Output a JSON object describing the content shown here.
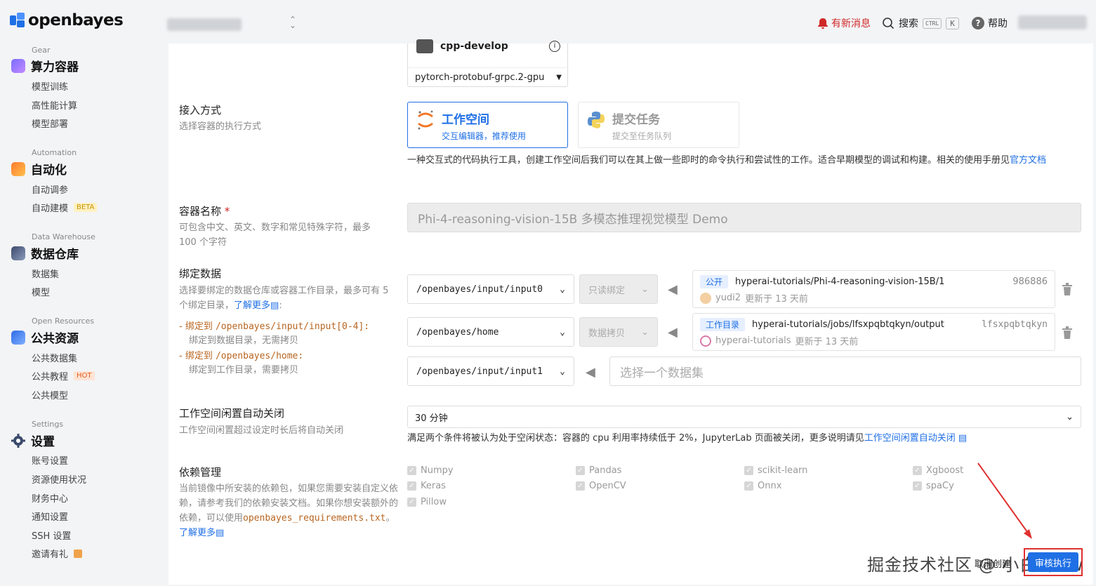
{
  "topbar": {
    "logo_text": "openbayes",
    "notification_label": "有新消息",
    "search_label": "搜索",
    "search_kbd_ctrl": "CTRL",
    "search_kbd_k": "K",
    "help_label": "帮助"
  },
  "sidebar": {
    "sections": [
      {
        "en": "Gear",
        "title": "算力容器",
        "items": [
          "模型训练",
          "高性能计算",
          "模型部署"
        ]
      },
      {
        "en": "Automation",
        "title": "自动化",
        "items": [
          "自动调参",
          "自动建模"
        ],
        "badge": "BETA"
      },
      {
        "en": "Data Warehouse",
        "title": "数据仓库",
        "items": [
          "数据集",
          "模型"
        ]
      },
      {
        "en": "Open Resources",
        "title": "公共资源",
        "items": [
          "公共数据集",
          "公共教程",
          "公共模型"
        ],
        "badge": "HOT"
      },
      {
        "en": "Settings",
        "title": "设置",
        "items": [
          "账号设置",
          "资源使用状况",
          "财务中心",
          "通知设置",
          "SSH 设置",
          "邀请有礼"
        ]
      }
    ]
  },
  "image": {
    "name": "cpp-develop",
    "version": "pytorch-protobuf-grpc.2-gpu"
  },
  "access": {
    "label": "接入方式",
    "desc": "选择容器的执行方式",
    "workspace_title": "工作空间",
    "workspace_sub": "交互编辑器，推荐使用",
    "task_title": "提交任务",
    "task_sub": "提交至任务队列",
    "note": "一种交互式的代码执行工具，创建工作空间后我们可以在其上做一些即时的命令执行和尝试性的工作。适合早期模型的调试和构建。相关的使用手册见",
    "note_link": "官方文档"
  },
  "container_name": {
    "label": "容器名称",
    "required": "*",
    "desc": "可包含中文、英文、数字和常见特殊字符，最多 100 个字符",
    "value": "Phi-4-reasoning-vision-15B 多模态推理视觉模型 Demo"
  },
  "bind": {
    "label": "绑定数据",
    "desc": "选择要绑定的数据仓库或容器工作目录，最多可有 5 个绑定目录，",
    "learn_more": "了解更多",
    "rule1_prefix": "绑定到",
    "rule1_path": "/openbayes/input/input[0-4]:",
    "rule1_desc": "绑定到数据目录，无需拷贝",
    "rule2_prefix": "绑定到",
    "rule2_path": "/openbayes/home:",
    "rule2_desc": "绑定到工作目录，需要拷贝",
    "rows": [
      {
        "dir": "/openbayes/input/input0",
        "mode": "只读绑定",
        "tag": "公开",
        "path": "hyperai-tutorials/Phi-4-reasoning-vision-15B/1",
        "id": "986886",
        "user": "yudi2",
        "updated": "更新于 13 天前"
      },
      {
        "dir": "/openbayes/home",
        "mode": "数据拷贝",
        "tag": "工作目录",
        "path": "hyperai-tutorials/jobs/lfsxpqbtqkyn/output",
        "id": "lfsxpqbtqkyn",
        "user": "hyperai-tutorials",
        "updated": "更新于 13 天前"
      },
      {
        "dir": "/openbayes/input/input1",
        "placeholder": "选择一个数据集"
      }
    ]
  },
  "idle": {
    "label": "工作空间闲置自动关闭",
    "desc": "工作空间闲置超过设定时长后将自动关闭",
    "value": "30 分钟",
    "note": "满足两个条件将被认为处于空闲状态：容器的 cpu 利用率持续低于 2%，JupyterLab 页面被关闭，更多说明请见",
    "note_link": "工作空间闲置自动关闭"
  },
  "deps": {
    "label": "依赖管理",
    "desc": "当前镜像中所安装的依赖包，如果您需要安装自定义依赖，请参考我们的依赖安装文档。如果你想安装额外的依赖，可以使用",
    "file": "openbayes_requirements.txt",
    "learn_more": "了解更多",
    "items": [
      "Numpy",
      "Pandas",
      "scikit-learn",
      "Xgboost",
      "Keras",
      "OpenCV",
      "Onnx",
      "spaCy",
      "Pillow"
    ]
  },
  "footer": {
    "watermark": "掘金技术社区 @ 小白狮ww",
    "cancel": "取消创建",
    "create": "审核执行"
  },
  "colors": {
    "accent": "#1f6fe5",
    "danger": "#e03030",
    "text": "#222222",
    "muted": "#888888"
  }
}
